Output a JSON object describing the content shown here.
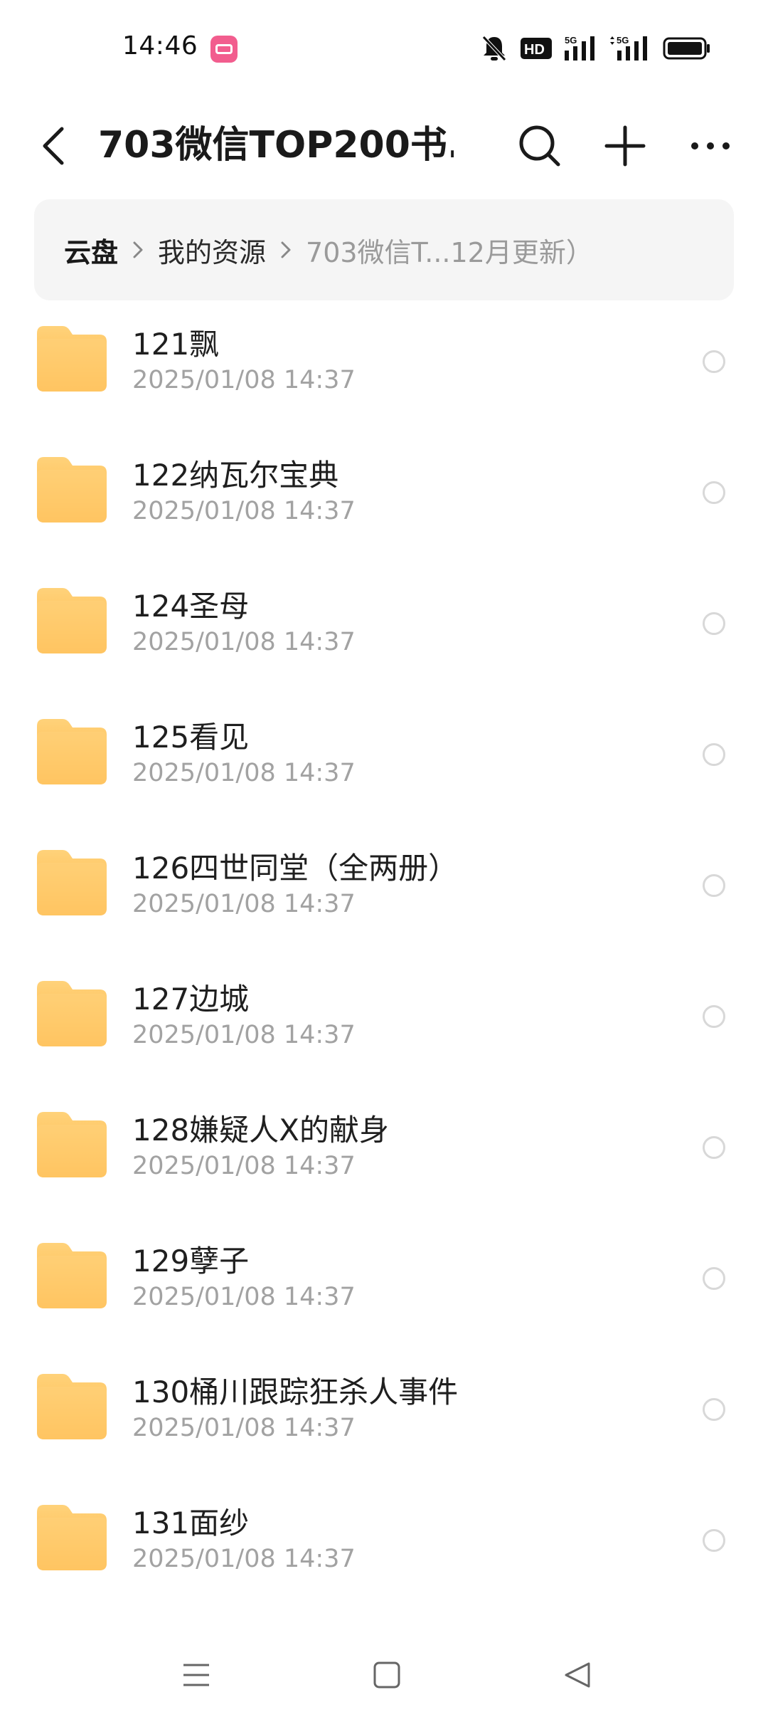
{
  "status_bar": {
    "time": "14:46",
    "app_icon": "bilibili-icon",
    "icons": [
      "bell-off-icon",
      "hd-icon",
      "signal-5g-icon",
      "signal-5g-icon",
      "battery-icon"
    ],
    "hd_label": "HD",
    "network_label": "5G"
  },
  "title_bar": {
    "title": "703微信TOP200书...",
    "icons": [
      "back-icon",
      "search-icon",
      "plus-icon",
      "more-icon"
    ]
  },
  "breadcrumb": {
    "root": "云盘",
    "middle": "我的资源",
    "current": "703微信T...12月更新）"
  },
  "files": [
    {
      "name": "121飘",
      "date": "2025/01/08 14:37"
    },
    {
      "name": "122纳瓦尔宝典",
      "date": "2025/01/08 14:37"
    },
    {
      "name": "124圣母",
      "date": "2025/01/08 14:37"
    },
    {
      "name": "125看见",
      "date": "2025/01/08 14:37"
    },
    {
      "name": "126四世同堂（全两册）",
      "date": "2025/01/08 14:37"
    },
    {
      "name": "127边城",
      "date": "2025/01/08 14:37"
    },
    {
      "name": "128嫌疑人X的献身",
      "date": "2025/01/08 14:37"
    },
    {
      "name": "129孽子",
      "date": "2025/01/08 14:37"
    },
    {
      "name": "130桶川跟踪狂杀人事件",
      "date": "2025/01/08 14:37"
    },
    {
      "name": "131面纱",
      "date": "2025/01/08 14:37"
    }
  ],
  "colors": {
    "folder_top": "#FFD27A",
    "folder_bottom": "#FFB544",
    "secondary_text": "#A2A2A2",
    "breadcrumb_bg": "#F5F5F5"
  },
  "nav_bar": {
    "icons": [
      "menu-icon",
      "home-square-icon",
      "back-triangle-icon"
    ]
  }
}
